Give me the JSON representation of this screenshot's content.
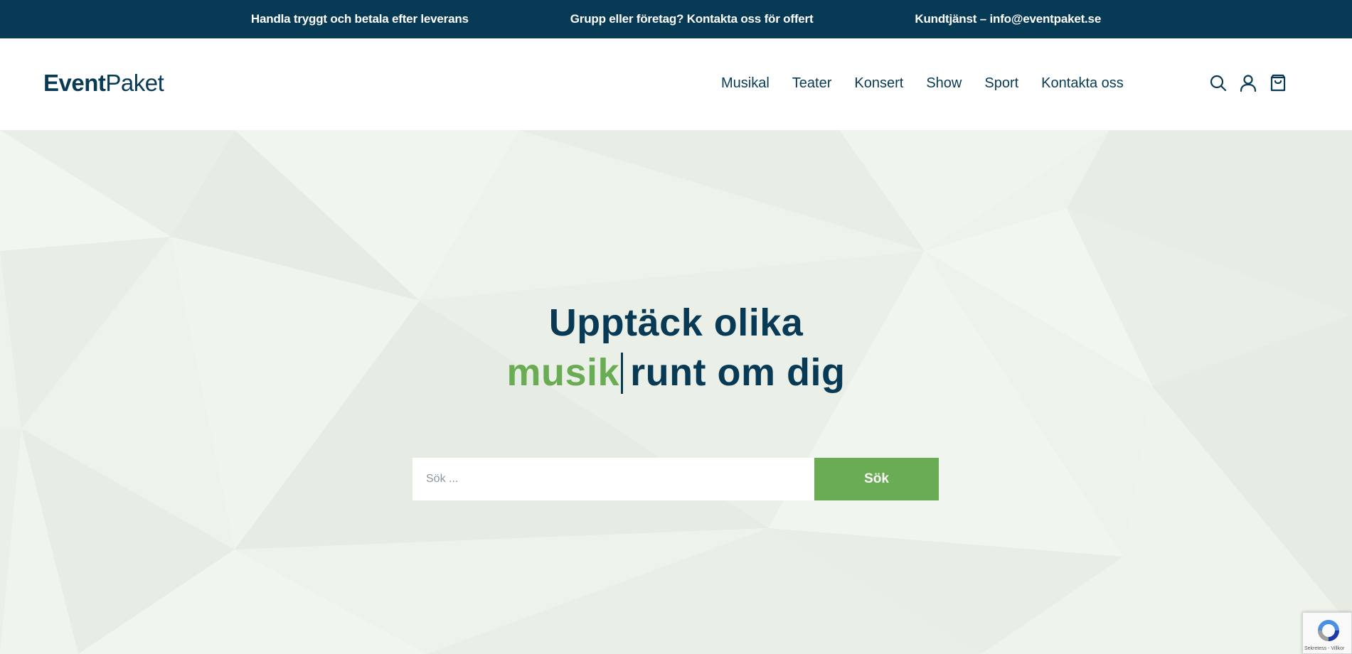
{
  "topbar": {
    "items": [
      "Handla tryggt och betala efter leverans",
      "Grupp eller företag? Kontakta oss för offert",
      "Kundtjänst – info@eventpaket.se"
    ]
  },
  "header": {
    "logo_bold": "Event",
    "logo_light": "Paket",
    "nav": [
      "Musikal",
      "Teater",
      "Konsert",
      "Show",
      "Sport",
      "Kontakta oss"
    ],
    "icons": [
      "search-icon",
      "user-icon",
      "cart-icon"
    ]
  },
  "hero": {
    "line1": "Upptäck olika",
    "accent_word": "musik",
    "line2_rest": "runt om dig",
    "search_placeholder": "Sök ...",
    "search_button": "Sök"
  },
  "recaptcha": {
    "text": "Sekretess - Villkor"
  },
  "colors": {
    "navy": "#073a55",
    "green": "#6aac53",
    "hero_bg": "#eef2ec"
  }
}
